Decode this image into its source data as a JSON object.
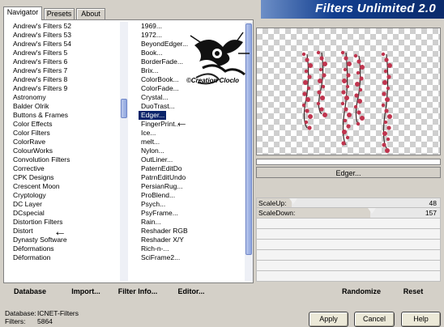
{
  "tabs": [
    "Navigator",
    "Presets",
    "About"
  ],
  "banner_title": "Filters Unlimited 2.0",
  "categories": [
    "Andrew's Filters 52",
    "Andrew's Filters 53",
    "Andrew's Filters 54",
    "Andrew's Filters 5",
    "Andrew's Filters 6",
    "Andrew's Filters 7",
    "Andrew's Filters 8",
    "Andrew's Filters 9",
    "Astronomy",
    "Balder Olrik",
    "Buttons & Frames",
    "Color Effects",
    "Color Filters",
    "ColorRave",
    "ColourWorks",
    "Convolution Filters",
    "Corrective",
    "CPK Designs",
    "Crescent Moon",
    "Cryptology",
    "DC Layer",
    "DCspecial",
    "Distortion Filters",
    "Distort",
    "Dynasty Software",
    "Déformations",
    "Déformation"
  ],
  "filters": [
    "1969...",
    "1972...",
    "BeyondEdger...",
    "Book...",
    "BorderFade...",
    "Brix...",
    "ColorBook...",
    "ColorFade...",
    "Crystal...",
    "DuoTrast...",
    "Edger...",
    "FingerPrint...",
    "Ice...",
    "melt...",
    "Nylon...",
    "OutLiner...",
    "PaternEditDo",
    "PatrnEditUndo",
    "PersianRug...",
    "ProBlend...",
    "Psych...",
    "PsyFrame...",
    "Rain...",
    "Reshader RGB",
    "Reshader X/Y",
    "Rich-n-...",
    "SciFrame2..."
  ],
  "selected_filter": "Edger...",
  "watermark_text": "©Creation Cloclo",
  "preview_filter_name": "Edger...",
  "params": [
    {
      "label": "ScaleUp:",
      "value": "48",
      "level": 0.19
    },
    {
      "label": "ScaleDown:",
      "value": "157",
      "level": 0.62
    }
  ],
  "list_buttons": {
    "database": "Database",
    "import": "Import...",
    "filter_info": "Filter Info...",
    "editor": "Editor..."
  },
  "right_buttons": {
    "randomize": "Randomize",
    "reset": "Reset"
  },
  "info": {
    "database_label": "Database:",
    "database_value": "ICNET-Filters",
    "filters_label": "Filters:",
    "filters_value": "5864"
  },
  "dialog_buttons": {
    "apply": "Apply",
    "cancel": "Cancel",
    "help": "Help"
  },
  "colors": {
    "selection": "#0a246a",
    "banner_dark": "#0a2a6a",
    "flower": "#c0344e"
  }
}
